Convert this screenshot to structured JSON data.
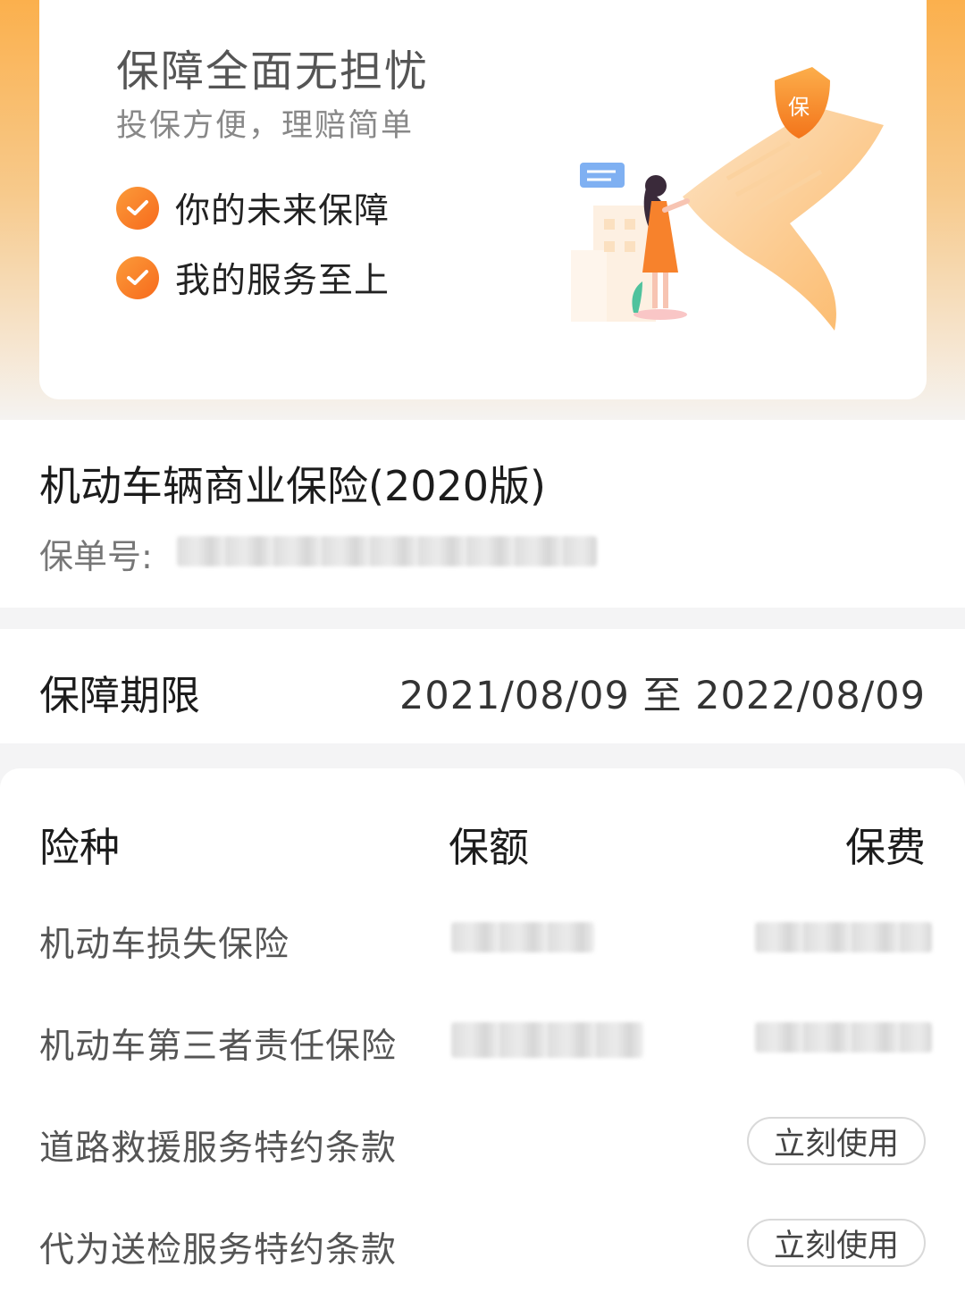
{
  "hero": {
    "title": "保障全面无担忧",
    "subtitle": "投保方便，理赔简单",
    "features": [
      "你的未来保障",
      "我的服务至上"
    ],
    "badge_char": "保",
    "accent": "#f7791f"
  },
  "policy": {
    "title": "机动车辆商业保险(2020版)",
    "number_label": "保单号:"
  },
  "period": {
    "label": "保障期限",
    "value": "2021/08/09 至 2022/08/09"
  },
  "coverage_table": {
    "headers": [
      "险种",
      "保额",
      "保费"
    ],
    "rows": [
      {
        "name": "机动车损失保险"
      },
      {
        "name": "机动车第三者责任保险"
      },
      {
        "name": "道路救援服务特约条款",
        "action": "立刻使用"
      },
      {
        "name": "代为送检服务特约条款",
        "action": "立刻使用"
      }
    ]
  }
}
